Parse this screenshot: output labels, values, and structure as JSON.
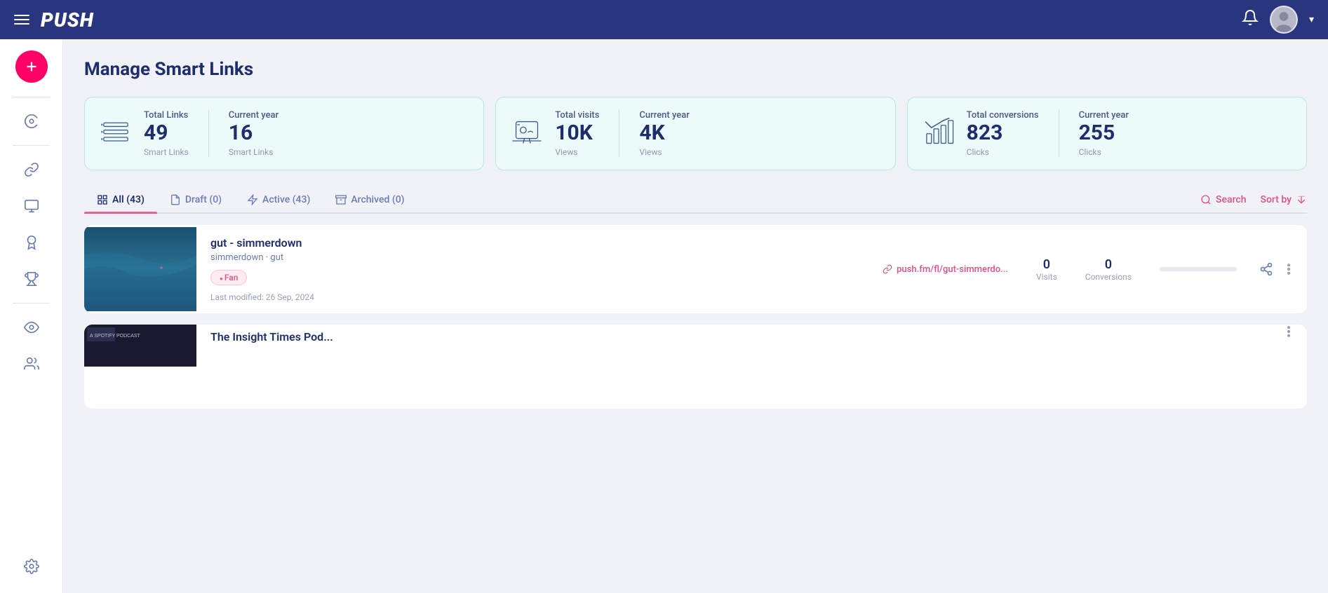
{
  "app": {
    "logo": "PUSH",
    "title": "Manage Smart Links"
  },
  "topNav": {
    "bell_label": "notifications",
    "chevron_label": "▾"
  },
  "stats": [
    {
      "label": "Total Links",
      "value": "49",
      "sub": "Smart Links",
      "current_year_label": "Current year",
      "current_year_value": "16",
      "current_year_sub": "Smart Links"
    },
    {
      "label": "Total visits",
      "value": "10K",
      "sub": "Views",
      "current_year_label": "Current year",
      "current_year_value": "4K",
      "current_year_sub": "Views"
    },
    {
      "label": "Total conversions",
      "value": "823",
      "sub": "Clicks",
      "current_year_label": "Current year",
      "current_year_value": "255",
      "current_year_sub": "Clicks"
    }
  ],
  "tabs": [
    {
      "id": "all",
      "label": "All (43)",
      "active": true
    },
    {
      "id": "draft",
      "label": "Draft (0)",
      "active": false
    },
    {
      "id": "active",
      "label": "Active (43)",
      "active": false
    },
    {
      "id": "archived",
      "label": "Archived (0)",
      "active": false
    }
  ],
  "toolbar": {
    "search_label": "Search",
    "sort_label": "Sort by"
  },
  "links": [
    {
      "title": "gut - simmerdown",
      "artist": "simmerdown · gut",
      "tag": "Fan",
      "url": "push.fm/fl/gut-simmerdo...",
      "visits": "0",
      "visits_label": "Visits",
      "conversions": "0",
      "conversions_label": "Conversions",
      "date": "Last modified: 26 Sep, 2024",
      "progress": 0
    },
    {
      "title": "The Insight Times Pod...",
      "artist": "",
      "tag": "",
      "url": "",
      "visits": "",
      "visits_label": "",
      "conversions": "",
      "conversions_label": "",
      "date": "",
      "progress": 0
    }
  ],
  "sidebar": {
    "add_label": "+",
    "icons": [
      {
        "name": "dashboard",
        "label": "dashboard-icon"
      },
      {
        "name": "links",
        "label": "link-icon"
      },
      {
        "name": "media",
        "label": "media-icon"
      },
      {
        "name": "badge",
        "label": "badge-icon"
      },
      {
        "name": "trophy",
        "label": "trophy-icon"
      },
      {
        "name": "eye",
        "label": "eye-icon"
      },
      {
        "name": "group",
        "label": "group-icon"
      },
      {
        "name": "settings",
        "label": "settings-icon"
      }
    ]
  }
}
